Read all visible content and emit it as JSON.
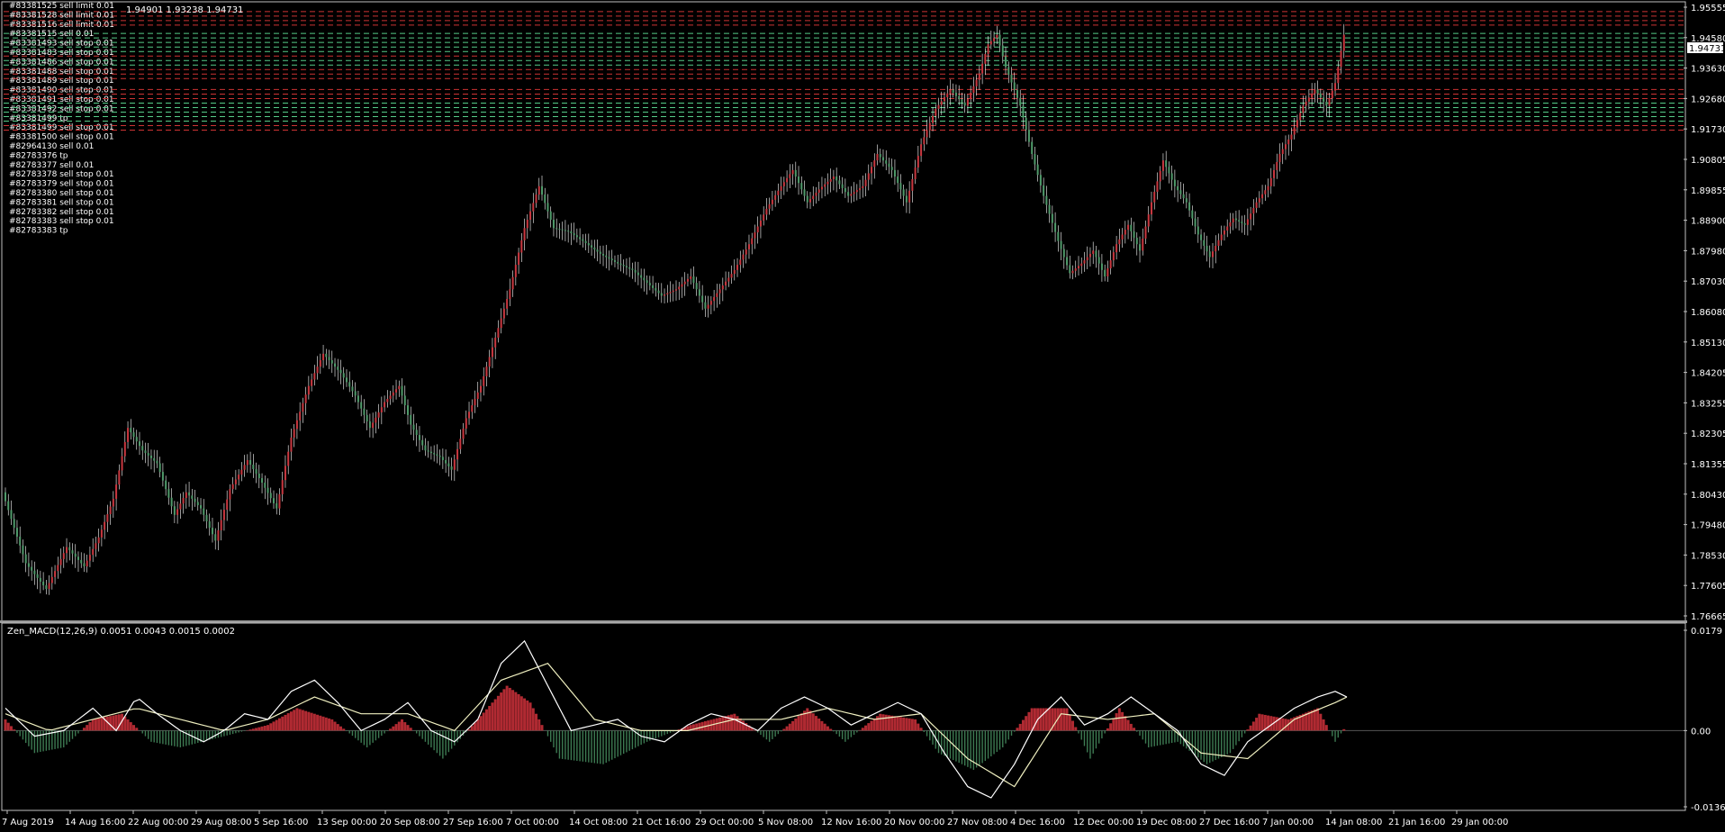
{
  "chart_data": [
    {
      "type": "candlestick",
      "pane": "price",
      "header": "1.94901 1.93238 1.94731",
      "current_price_label": "1.94731",
      "ylim": [
        1.76665,
        1.95555
      ],
      "y_ticks": [
        "1.95555",
        "1.94580",
        "1.93630",
        "1.92680",
        "1.91730",
        "1.90805",
        "1.89855",
        "1.88900",
        "1.87980",
        "1.87030",
        "1.86080",
        "1.85130",
        "1.84205",
        "1.83255",
        "1.82305",
        "1.81355",
        "1.80430",
        "1.79480",
        "1.78530",
        "1.77605",
        "1.76665"
      ],
      "x_ticks": [
        "7 Aug 2019",
        "14 Aug 16:00",
        "22 Aug 00:00",
        "29 Aug 08:00",
        "5 Sep 16:00",
        "13 Sep 00:00",
        "20 Sep 08:00",
        "27 Sep 16:00",
        "7 Oct 00:00",
        "14 Oct 08:00",
        "21 Oct 16:00",
        "29 Oct 00:00",
        "5 Nov 08:00",
        "12 Nov 16:00",
        "20 Nov 00:00",
        "27 Nov 08:00",
        "4 Dec 16:00",
        "12 Dec 00:00",
        "19 Dec 08:00",
        "27 Dec 16:00",
        "7 Jan 00:00",
        "14 Jan 08:00",
        "21 Jan 16:00",
        "29 Jan 00:00"
      ],
      "close_path": [
        [
          0,
          1.805
        ],
        [
          8,
          1.783
        ],
        [
          15,
          1.775
        ],
        [
          22,
          1.788
        ],
        [
          28,
          1.782
        ],
        [
          33,
          1.791
        ],
        [
          38,
          1.803
        ],
        [
          43,
          1.825
        ],
        [
          48,
          1.818
        ],
        [
          53,
          1.814
        ],
        [
          59,
          1.798
        ],
        [
          63,
          1.805
        ],
        [
          68,
          1.8
        ],
        [
          73,
          1.79
        ],
        [
          78,
          1.806
        ],
        [
          84,
          1.815
        ],
        [
          89,
          1.808
        ],
        [
          94,
          1.8
        ],
        [
          99,
          1.822
        ],
        [
          105,
          1.838
        ],
        [
          110,
          1.848
        ],
        [
          116,
          1.842
        ],
        [
          121,
          1.835
        ],
        [
          126,
          1.825
        ],
        [
          131,
          1.833
        ],
        [
          136,
          1.838
        ],
        [
          140,
          1.826
        ],
        [
          145,
          1.818
        ],
        [
          150,
          1.816
        ],
        [
          154,
          1.812
        ],
        [
          159,
          1.828
        ],
        [
          164,
          1.838
        ],
        [
          169,
          1.853
        ],
        [
          174,
          1.868
        ],
        [
          179,
          1.887
        ],
        [
          184,
          1.9
        ],
        [
          189,
          1.887
        ],
        [
          194,
          1.886
        ],
        [
          199,
          1.883
        ],
        [
          205,
          1.879
        ],
        [
          211,
          1.876
        ],
        [
          216,
          1.874
        ],
        [
          221,
          1.87
        ],
        [
          226,
          1.866
        ],
        [
          231,
          1.868
        ],
        [
          236,
          1.872
        ],
        [
          241,
          1.862
        ],
        [
          246,
          1.868
        ],
        [
          251,
          1.874
        ],
        [
          256,
          1.882
        ],
        [
          262,
          1.893
        ],
        [
          267,
          1.9
        ],
        [
          271,
          1.905
        ],
        [
          276,
          1.895
        ],
        [
          280,
          1.899
        ],
        [
          285,
          1.903
        ],
        [
          290,
          1.897
        ],
        [
          295,
          1.9
        ],
        [
          300,
          1.91
        ],
        [
          305,
          1.905
        ],
        [
          310,
          1.895
        ],
        [
          315,
          1.913
        ],
        [
          320,
          1.924
        ],
        [
          325,
          1.93
        ],
        [
          330,
          1.925
        ],
        [
          335,
          1.935
        ],
        [
          338,
          1.944
        ],
        [
          341,
          1.947
        ],
        [
          344,
          1.937
        ],
        [
          349,
          1.925
        ],
        [
          353,
          1.91
        ],
        [
          357,
          1.897
        ],
        [
          362,
          1.883
        ],
        [
          366,
          1.873
        ],
        [
          370,
          1.876
        ],
        [
          374,
          1.88
        ],
        [
          378,
          1.872
        ],
        [
          382,
          1.882
        ],
        [
          386,
          1.888
        ],
        [
          390,
          1.88
        ],
        [
          394,
          1.895
        ],
        [
          398,
          1.908
        ],
        [
          402,
          1.9
        ],
        [
          406,
          1.895
        ],
        [
          410,
          1.885
        ],
        [
          414,
          1.878
        ],
        [
          418,
          1.885
        ],
        [
          422,
          1.89
        ],
        [
          426,
          1.888
        ],
        [
          430,
          1.895
        ],
        [
          434,
          1.9
        ],
        [
          438,
          1.91
        ],
        [
          442,
          1.916
        ],
        [
          446,
          1.925
        ],
        [
          450,
          1.93
        ],
        [
          454,
          1.925
        ],
        [
          457,
          1.932
        ],
        [
          460,
          1.947
        ]
      ],
      "order_lines": [
        {
          "label": "#83381525 sell limit 0.01",
          "price": 1.9542,
          "color": "#cc3333"
        },
        {
          "label": "#83381528 sell limit 0.01",
          "price": 1.9528,
          "color": "#cc3333"
        },
        {
          "label": "#83381516 sell limit 0.01",
          "price": 1.9514,
          "color": "#cc3333"
        },
        {
          "label": "#83381515 sell 0.01",
          "price": 1.95,
          "color": "#cc3333"
        },
        {
          "label": "#83381493 sell stop 0.01",
          "price": 1.9474,
          "color": "#55cc88"
        },
        {
          "label": "#83381483 sell stop 0.01",
          "price": 1.946,
          "color": "#55cc88"
        },
        {
          "label": "#83381486 sell stop 0.01",
          "price": 1.9446,
          "color": "#55cc88"
        },
        {
          "label": "#83381488 sell stop 0.01",
          "price": 1.9432,
          "color": "#55cc88"
        },
        {
          "label": "#83381489 sell stop 0.01",
          "price": 1.9418,
          "color": "#55cc88"
        },
        {
          "label": "#83381490 sell stop 0.01",
          "price": 1.9404,
          "color": "#cc3333"
        },
        {
          "label": "#83381491 sell stop 0.01",
          "price": 1.939,
          "color": "#55cc88"
        },
        {
          "label": "#83381492 sell stop 0.01",
          "price": 1.9376,
          "color": "#55cc88"
        },
        {
          "label": "#83381499 tp",
          "price": 1.9362,
          "color": "#cc3333"
        },
        {
          "label": "#83381499 sell stop 0.01",
          "price": 1.9348,
          "color": "#cc3333"
        },
        {
          "label": "#83381500 sell stop 0.01",
          "price": 1.9334,
          "color": "#cc3333"
        },
        {
          "label": "#82964130 sell 0.01",
          "price": 1.93,
          "color": "#cc3333"
        },
        {
          "label": "#82783376 tp",
          "price": 1.9286,
          "color": "#cc3333"
        },
        {
          "label": "#82783377 sell 0.01",
          "price": 1.9272,
          "color": "#cc3333"
        },
        {
          "label": "#82783378 sell stop 0.01",
          "price": 1.9258,
          "color": "#55cc88"
        },
        {
          "label": "#82783379 sell stop 0.01",
          "price": 1.9244,
          "color": "#55cc88"
        },
        {
          "label": "#82783380 sell stop 0.01",
          "price": 1.923,
          "color": "#55cc88"
        },
        {
          "label": "#82783381 sell stop 0.01",
          "price": 1.9216,
          "color": "#55cc88"
        },
        {
          "label": "#82783382 sell stop 0.01",
          "price": 1.9202,
          "color": "#55cc88"
        },
        {
          "label": "#82783383 sell stop 0.01",
          "price": 1.9188,
          "color": "#cc3333"
        },
        {
          "label": "#82783383 tp",
          "price": 1.9174,
          "color": "#cc3333"
        }
      ]
    },
    {
      "type": "macd",
      "pane": "indicator",
      "header": "Zen_MACD(12,26,9) 0.0051 0.0043 0.0015 0.0002",
      "ylim": [
        -0.0136,
        0.0179
      ],
      "y_ticks": [
        "0.0179",
        "0.00",
        "-0.0136"
      ],
      "macd_path": [
        [
          0,
          0.004
        ],
        [
          10,
          -0.001
        ],
        [
          20,
          0.0
        ],
        [
          30,
          0.004
        ],
        [
          38,
          0.0
        ],
        [
          45,
          0.006
        ],
        [
          52,
          0.003
        ],
        [
          60,
          0.0
        ],
        [
          68,
          -0.002
        ],
        [
          75,
          0.0
        ],
        [
          82,
          0.003
        ],
        [
          90,
          0.002
        ],
        [
          98,
          0.007
        ],
        [
          106,
          0.009
        ],
        [
          114,
          0.005
        ],
        [
          122,
          0.0
        ],
        [
          130,
          0.002
        ],
        [
          138,
          0.005
        ],
        [
          146,
          0.0
        ],
        [
          154,
          -0.002
        ],
        [
          162,
          0.002
        ],
        [
          170,
          0.012
        ],
        [
          178,
          0.016
        ],
        [
          186,
          0.008
        ],
        [
          194,
          0.0
        ],
        [
          202,
          0.001
        ],
        [
          210,
          0.002
        ],
        [
          218,
          -0.001
        ],
        [
          226,
          -0.002
        ],
        [
          234,
          0.001
        ],
        [
          242,
          0.003
        ],
        [
          250,
          0.002
        ],
        [
          258,
          0.0
        ],
        [
          266,
          0.004
        ],
        [
          274,
          0.006
        ],
        [
          282,
          0.004
        ],
        [
          290,
          0.001
        ],
        [
          298,
          0.003
        ],
        [
          306,
          0.005
        ],
        [
          314,
          0.003
        ],
        [
          322,
          -0.004
        ],
        [
          330,
          -0.01
        ],
        [
          338,
          -0.012
        ],
        [
          346,
          -0.006
        ],
        [
          354,
          0.002
        ],
        [
          362,
          0.006
        ],
        [
          370,
          0.001
        ],
        [
          378,
          0.003
        ],
        [
          386,
          0.006
        ],
        [
          394,
          0.003
        ],
        [
          402,
          0.0
        ],
        [
          410,
          -0.006
        ],
        [
          418,
          -0.008
        ],
        [
          426,
          -0.002
        ],
        [
          434,
          0.001
        ],
        [
          442,
          0.004
        ],
        [
          450,
          0.006
        ],
        [
          456,
          0.007
        ],
        [
          460,
          0.006
        ]
      ],
      "signal_path": [
        [
          0,
          0.003
        ],
        [
          15,
          0.0
        ],
        [
          30,
          0.002
        ],
        [
          45,
          0.004
        ],
        [
          60,
          0.002
        ],
        [
          75,
          0.0
        ],
        [
          90,
          0.002
        ],
        [
          106,
          0.006
        ],
        [
          122,
          0.003
        ],
        [
          138,
          0.003
        ],
        [
          154,
          0.0
        ],
        [
          170,
          0.009
        ],
        [
          186,
          0.012
        ],
        [
          202,
          0.002
        ],
        [
          218,
          0.0
        ],
        [
          234,
          0.0
        ],
        [
          250,
          0.002
        ],
        [
          266,
          0.002
        ],
        [
          282,
          0.004
        ],
        [
          298,
          0.002
        ],
        [
          314,
          0.003
        ],
        [
          330,
          -0.005
        ],
        [
          346,
          -0.01
        ],
        [
          362,
          0.003
        ],
        [
          378,
          0.002
        ],
        [
          394,
          0.003
        ],
        [
          410,
          -0.004
        ],
        [
          426,
          -0.005
        ],
        [
          442,
          0.002
        ],
        [
          456,
          0.005
        ],
        [
          460,
          0.006
        ]
      ],
      "hist_path": [
        [
          0,
          0.002
        ],
        [
          10,
          -0.004
        ],
        [
          20,
          -0.003
        ],
        [
          30,
          0.002
        ],
        [
          40,
          0.003
        ],
        [
          50,
          -0.002
        ],
        [
          60,
          -0.003
        ],
        [
          75,
          -0.001
        ],
        [
          90,
          0.001
        ],
        [
          100,
          0.004
        ],
        [
          112,
          0.002
        ],
        [
          124,
          -0.003
        ],
        [
          136,
          0.002
        ],
        [
          150,
          -0.005
        ],
        [
          162,
          0.002
        ],
        [
          172,
          0.008
        ],
        [
          180,
          0.005
        ],
        [
          190,
          -0.005
        ],
        [
          205,
          -0.006
        ],
        [
          220,
          -0.002
        ],
        [
          235,
          0.001
        ],
        [
          250,
          0.003
        ],
        [
          262,
          -0.002
        ],
        [
          275,
          0.004
        ],
        [
          288,
          -0.002
        ],
        [
          300,
          0.003
        ],
        [
          312,
          0.002
        ],
        [
          320,
          -0.004
        ],
        [
          332,
          -0.007
        ],
        [
          342,
          -0.003
        ],
        [
          352,
          0.004
        ],
        [
          364,
          0.004
        ],
        [
          372,
          -0.005
        ],
        [
          382,
          0.004
        ],
        [
          392,
          -0.003
        ],
        [
          402,
          -0.002
        ],
        [
          412,
          -0.006
        ],
        [
          420,
          -0.004
        ],
        [
          430,
          0.003
        ],
        [
          440,
          0.002
        ],
        [
          450,
          0.004
        ],
        [
          456,
          -0.002
        ],
        [
          460,
          0.001
        ]
      ]
    }
  ],
  "colors": {
    "background": "#000000",
    "grid_border": "#c0c0c0",
    "bull": "#c9373f",
    "bear": "#4f9a6a",
    "wick_text": "#ffffff",
    "macd_line": "#ffffff",
    "signal_line": "#f0f0c0",
    "hist_up": "#b02a32",
    "hist_down": "#3d7a52"
  }
}
